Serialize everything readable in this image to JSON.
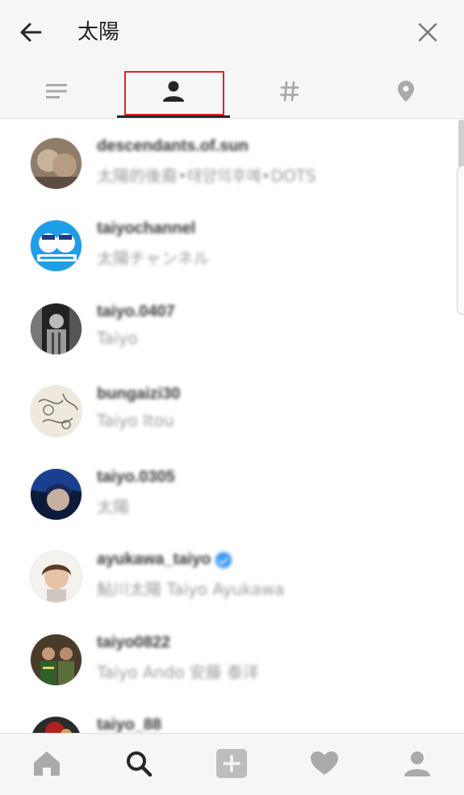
{
  "header": {
    "search_query": "太陽",
    "back_icon": "arrow-left-icon",
    "clear_icon": "close-icon"
  },
  "tabs": [
    {
      "id": "top",
      "icon": "list-icon",
      "active": false
    },
    {
      "id": "people",
      "icon": "person-icon",
      "active": true
    },
    {
      "id": "tags",
      "icon": "hashtag-icon",
      "active": false
    },
    {
      "id": "places",
      "icon": "location-pin-icon",
      "active": false
    }
  ],
  "results": [
    {
      "username": "descendants.of.sun",
      "full_name": "太陽的後裔•태양의후예•DOTS",
      "verified": false
    },
    {
      "username": "taiyochannel",
      "full_name": "太陽チャンネル",
      "verified": false
    },
    {
      "username": "taiyo.0407",
      "full_name": "Taiyo",
      "verified": false
    },
    {
      "username": "bungaizi30",
      "full_name": "Taiyo Itou",
      "verified": false
    },
    {
      "username": "taiyo.0305",
      "full_name": "太陽",
      "verified": false
    },
    {
      "username": "ayukawa_taiyo",
      "full_name": "鮎川太陽 Taiyo Ayukawa",
      "verified": true
    },
    {
      "username": "taiyo0822",
      "full_name": "Taiyo Ando 安藤 泰洋",
      "verified": false
    },
    {
      "username": "taiyo_88",
      "full_name": "",
      "verified": false
    }
  ],
  "bottom_nav": [
    {
      "id": "home",
      "icon": "home-icon"
    },
    {
      "id": "search",
      "icon": "search-icon",
      "active": true
    },
    {
      "id": "add",
      "icon": "plus-icon"
    },
    {
      "id": "activity",
      "icon": "heart-icon"
    },
    {
      "id": "profile",
      "icon": "profile-icon"
    }
  ],
  "colors": {
    "highlight": "#d9262a",
    "verified": "#3897f0",
    "icon_inactive": "#aaaaaa",
    "icon_active": "#262626"
  }
}
